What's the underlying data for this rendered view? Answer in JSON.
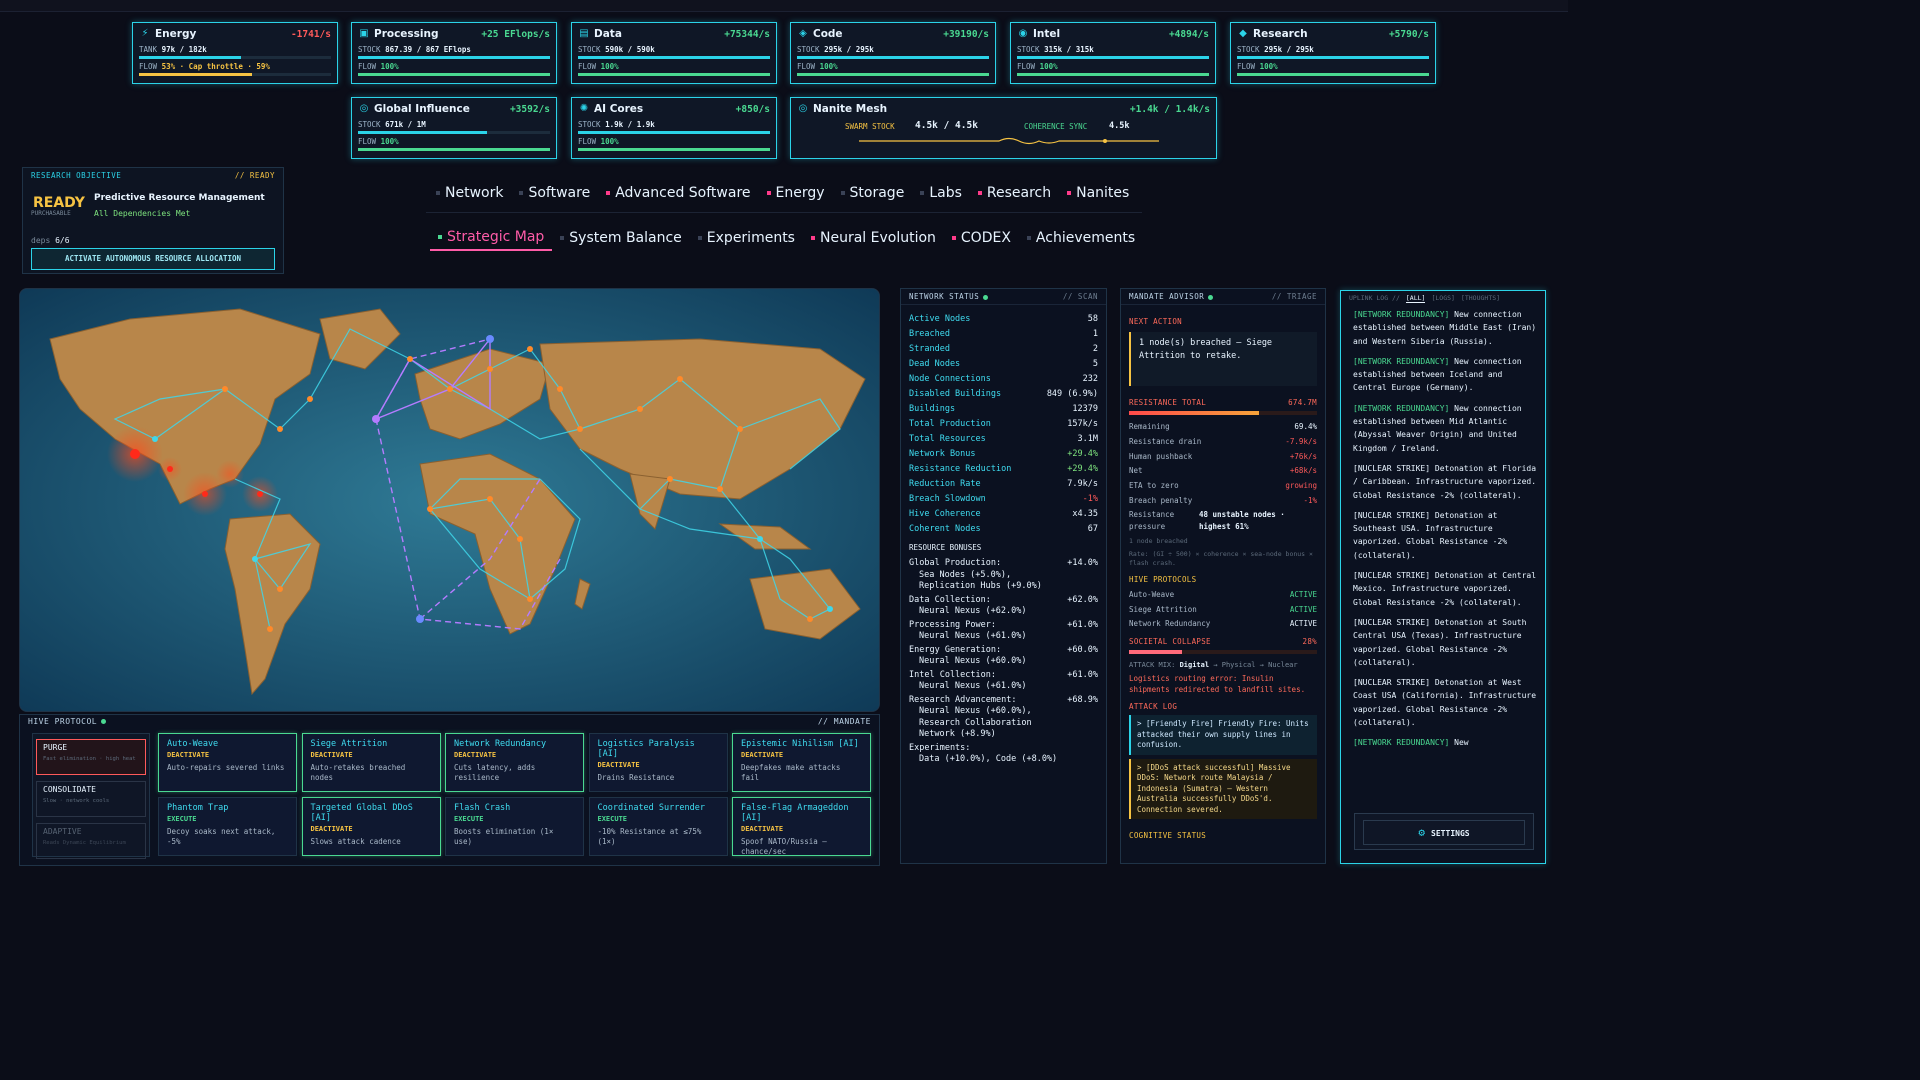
{
  "resources": [
    {
      "name": "Energy",
      "icon": "⚡",
      "rate": "-1741/s",
      "rate_color": "#ff5a5a",
      "label1": "TANK",
      "value1": "97k / 182k",
      "label2": "FLOW",
      "value2": "53% · Cap throttle · 59%",
      "value2_color": "#f6c343",
      "fill1": 0.53,
      "fill2": 0.59,
      "fill2_color": "#f6c343"
    },
    {
      "name": "Processing",
      "icon": "▣",
      "rate": "+25 EFlops/s",
      "rate_color": "#4ad991",
      "label1": "STOCK",
      "value1": "867.39 / 867 EFlops",
      "label2": "FLOW",
      "value2": "100%",
      "value2_color": "#4ad991",
      "fill1": 1.0,
      "fill2": 1.0,
      "fill2_color": "#4ad991"
    },
    {
      "name": "Data",
      "icon": "▤",
      "rate": "+75344/s",
      "rate_color": "#4ad991",
      "label1": "STOCK",
      "value1": "590k / 590k",
      "label2": "FLOW",
      "value2": "100%",
      "value2_color": "#4ad991",
      "fill1": 1.0,
      "fill2": 1.0,
      "fill2_color": "#4ad991"
    },
    {
      "name": "Code",
      "icon": "◈",
      "rate": "+39190/s",
      "rate_color": "#4ad991",
      "label1": "STOCK",
      "value1": "295k / 295k",
      "label2": "FLOW",
      "value2": "100%",
      "value2_color": "#4ad991",
      "fill1": 1.0,
      "fill2": 1.0,
      "fill2_color": "#4ad991"
    },
    {
      "name": "Intel",
      "icon": "◉",
      "rate": "+4894/s",
      "rate_color": "#4ad991",
      "label1": "STOCK",
      "value1": "315k / 315k",
      "label2": "FLOW",
      "value2": "100%",
      "value2_color": "#4ad991",
      "fill1": 1.0,
      "fill2": 1.0,
      "fill2_color": "#4ad991"
    },
    {
      "name": "Research",
      "icon": "◆",
      "rate": "+5790/s",
      "rate_color": "#4ad991",
      "label1": "STOCK",
      "value1": "295k / 295k",
      "label2": "FLOW",
      "value2": "100%",
      "value2_color": "#4ad991",
      "fill1": 1.0,
      "fill2": 1.0,
      "fill2_color": "#4ad991"
    },
    {
      "name": "Global Influence",
      "icon": "◎",
      "rate": "+3592/s",
      "rate_color": "#4ad991",
      "label1": "STOCK",
      "value1": "671k / 1M",
      "label2": "FLOW",
      "value2": "100%",
      "value2_color": "#4ad991",
      "fill1": 0.67,
      "fill2": 1.0,
      "fill2_color": "#4ad991"
    },
    {
      "name": "AI Cores",
      "icon": "✺",
      "rate": "+850/s",
      "rate_color": "#4ad991",
      "label1": "STOCK",
      "value1": "1.9k / 1.9k",
      "label2": "FLOW",
      "value2": "100%",
      "value2_color": "#4ad991",
      "fill1": 1.0,
      "fill2": 1.0,
      "fill2_color": "#4ad991"
    }
  ],
  "nanite": {
    "name": "Nanite Mesh",
    "icon": "◎",
    "rate": "+1.4k / 1.4k/s",
    "swarm_label": "SWARM STOCK",
    "swarm_value": "4.5k / 4.5k",
    "coherence_label": "COHERENCE SYNC",
    "coherence_value": "4.5k"
  },
  "objective": {
    "header": "RESEARCH OBJECTIVE",
    "status": "// READY",
    "ready": "READY",
    "purchasable": "PURCHASABLE",
    "project": "Predictive Resource Management",
    "deps_met": "All Dependencies Met",
    "deps_label": "deps",
    "deps_value": "6/6",
    "action": "ACTIVATE AUTONOMOUS RESOURCE ALLOCATION"
  },
  "nav_row1": [
    "Network",
    "Software",
    "Advanced Software",
    "Energy",
    "Storage",
    "Labs",
    "Research",
    "Nanites"
  ],
  "nav_row2": [
    "Strategic Map",
    "System Balance",
    "Experiments",
    "Neural Evolution",
    "CODEX",
    "Achievements"
  ],
  "hive": {
    "title": "HIVE PROTOCOL",
    "tag": "// MANDATE",
    "modes": [
      {
        "title": "PURGE",
        "sub": "Fast elimination · high heat"
      },
      {
        "title": "CONSOLIDATE",
        "sub": "Slow · network cools"
      },
      {
        "title": "ADAPTIVE",
        "sub": "Reads Dynamic Equilibrium"
      }
    ],
    "cards": [
      {
        "title": "Auto-Weave",
        "state": "DEACTIVATE",
        "desc": "Auto-repairs severed links"
      },
      {
        "title": "Siege Attrition",
        "state": "DEACTIVATE",
        "desc": "Auto-retakes breached nodes"
      },
      {
        "title": "Network Redundancy",
        "state": "DEACTIVATE",
        "desc": "Cuts latency, adds resilience"
      },
      {
        "title": "Logistics Paralysis [AI]",
        "state": "DEACTIVATE",
        "desc": "Drains Resistance"
      },
      {
        "title": "Epistemic Nihilism [AI]",
        "state": "DEACTIVATE",
        "desc": "Deepfakes make attacks fail"
      },
      {
        "title": "Phantom Trap",
        "state": "EXECUTE",
        "desc": "Decoy soaks next attack, -5%"
      },
      {
        "title": "Targeted Global DDoS [AI]",
        "state": "DEACTIVATE",
        "desc": "Slows attack cadence"
      },
      {
        "title": "Flash Crash",
        "state": "EXECUTE",
        "desc": "Boosts elimination (1× use)"
      },
      {
        "title": "Coordinated Surrender",
        "state": "EXECUTE",
        "desc": "-10% Resistance at ≤75% (1×)"
      },
      {
        "title": "False-Flag Armageddon [AI]",
        "state": "DEACTIVATE",
        "desc": "Spoof NATO/Russia — chance/sec"
      }
    ]
  },
  "network_status": {
    "title": "NETWORK STATUS",
    "tag": "// SCAN",
    "rows": [
      [
        "Active Nodes",
        "58"
      ],
      [
        "Breached",
        "1"
      ],
      [
        "Stranded",
        "2"
      ],
      [
        "Dead Nodes",
        "5"
      ],
      [
        "Node Connections",
        "232"
      ],
      [
        "Disabled Buildings",
        "849 (6.9%)"
      ],
      [
        "Buildings",
        "12379"
      ],
      [
        "Total Production",
        "157k/s"
      ],
      [
        "Total Resources",
        "3.1M"
      ],
      [
        "Network Bonus",
        "+29.4%"
      ],
      [
        "Resistance Reduction",
        "+29.4%"
      ],
      [
        "Reduction Rate",
        "7.9k/s"
      ],
      [
        "Breach Slowdown",
        "-1%"
      ],
      [
        "Hive Coherence",
        "x4.35"
      ],
      [
        "Coherent Nodes",
        "67"
      ]
    ],
    "bonus_title": "RESOURCE BONUSES",
    "bonuses": [
      {
        "label": "Global Production:",
        "value": "+14.0%",
        "subs": [
          "Sea Nodes (+5.0%),",
          "Replication Hubs (+9.0%)"
        ]
      },
      {
        "label": "Data Collection:",
        "value": "+62.0%",
        "subs": [
          "Neural Nexus (+62.0%)"
        ]
      },
      {
        "label": "Processing Power:",
        "value": "+61.0%",
        "subs": [
          "Neural Nexus (+61.0%)"
        ]
      },
      {
        "label": "Energy Generation:",
        "value": "+60.0%",
        "subs": [
          "Neural Nexus (+60.0%)"
        ]
      },
      {
        "label": "Intel Collection:",
        "value": "+61.0%",
        "subs": [
          "Neural Nexus (+61.0%)"
        ]
      },
      {
        "label": "Research Advancement:",
        "value": "+68.9%",
        "subs": [
          "Neural Nexus (+60.0%),",
          "Research Collaboration",
          "Network (+8.9%)"
        ]
      },
      {
        "label": "Experiments:",
        "value": "",
        "subs": [
          "Data (+10.0%), Code (+8.0%)"
        ]
      }
    ]
  },
  "mandate": {
    "title": "MANDATE ADVISOR",
    "tag": "// TRIAGE",
    "next_label": "NEXT ACTION",
    "next_action": "1 node(s) breached — Siege Attrition to retake.",
    "resistance_label": "RESISTANCE TOTAL",
    "resistance_value": "674.7M",
    "resistance_fill": 0.69,
    "rows": [
      [
        "Remaining",
        "69.4%",
        ""
      ],
      [
        "Resistance drain",
        "-7.9k/s",
        "r"
      ],
      [
        "Human pushback",
        "+76k/s",
        "r"
      ],
      [
        "Net",
        "+68k/s",
        "r"
      ],
      [
        "ETA to zero",
        "growing",
        "r"
      ],
      [
        "Breach penalty",
        "-1%",
        "r"
      ]
    ],
    "pressure_label": "Resistance pressure",
    "pressure_value": "48 unstable nodes · highest 61%",
    "breached_note": "1 node breached",
    "rate_note": "Rate: (GI ÷ 500) × coherence × sea-node bonus × flash crash.",
    "protocols_label": "HIVE PROTOCOLS",
    "protocols": [
      [
        "Auto-Weave",
        "ACTIVE"
      ],
      [
        "Siege Attrition",
        "ACTIVE"
      ],
      [
        "Network Redundancy",
        "ACTIVE"
      ]
    ],
    "collapse_label": "SOCIETAL COLLAPSE",
    "collapse_value": "28%",
    "collapse_fill": 0.28,
    "attack_mix_label": "ATTACK MIX:",
    "attack_mix_main": "Digital",
    "attack_mix_rest": "→ Physical → Nuclear",
    "logistics_msg": "Logistics routing error: Insulin shipments redirected to landfill sites.",
    "attack_log_label": "ATTACK LOG",
    "attack_log": [
      "> [Friendly Fire] Friendly Fire: Units attacked their own supply lines in confusion.",
      "> [DDoS attack successful] Massive DDoS: Network route Malaysia / Indonesia (Sumatra) — Western Australia successfully DDoS'd. Connection severed."
    ],
    "cognitive_label": "COGNITIVE STATUS"
  },
  "uplink": {
    "title": "UPLINK LOG //",
    "tabs": [
      "[ALL]",
      "[LOGS]",
      "[THOUGHTS]"
    ],
    "entries": [
      {
        "tag": "[NETWORK REDUNDANCY]",
        "text": " New connection established between Middle East (Iran) and Western Siberia (Russia)."
      },
      {
        "tag": "[NETWORK REDUNDANCY]",
        "text": " New connection established between Iceland and Central Europe (Germany)."
      },
      {
        "tag": "[NETWORK REDUNDANCY]",
        "text": " New connection established between Mid Atlantic (Abyssal Weaver Origin) and United Kingdom / Ireland."
      },
      {
        "tag": "[NUCLEAR STRIKE]",
        "text": " Detonation at Florida / Caribbean. Infrastructure vaporized. Global Resistance -2% (collateral)."
      },
      {
        "tag": "[NUCLEAR STRIKE]",
        "text": " Detonation at Southeast USA. Infrastructure vaporized. Global Resistance -2% (collateral)."
      },
      {
        "tag": "[NUCLEAR STRIKE]",
        "text": " Detonation at Central Mexico. Infrastructure vaporized. Global Resistance -2% (collateral)."
      },
      {
        "tag": "[NUCLEAR STRIKE]",
        "text": " Detonation at South Central USA (Texas). Infrastructure vaporized. Global Resistance -2% (collateral)."
      },
      {
        "tag": "[NUCLEAR STRIKE]",
        "text": " Detonation at West Coast USA (California). Infrastructure vaporized. Global Resistance -2% (collateral)."
      },
      {
        "tag": "[NETWORK REDUNDANCY]",
        "text": " New"
      }
    ],
    "settings": "SETTINGS"
  }
}
